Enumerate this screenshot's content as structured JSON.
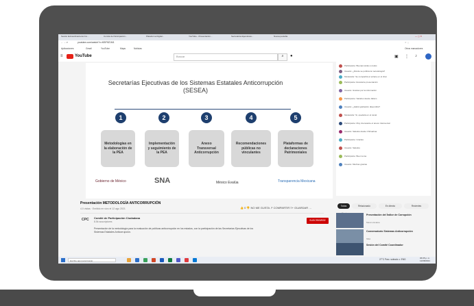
{
  "browser": {
    "tabs": [
      "Sesión Extraordinaria del Co...",
      "Comité de Participación...",
      "Plataforma Digital...",
      "YouTube - Presentación...",
      "Secretarías Ejecutivas...",
      "Nueva pestaña"
    ],
    "url": "youtube.com/watch?v=KBF9Z1M1",
    "bookmarks": [
      "Aplicaciones",
      "Gmail",
      "YouTube",
      "Maps",
      "Noticias",
      "Otros marcadores"
    ]
  },
  "youtube": {
    "logo": "YouTube",
    "search_placeholder": "Buscar"
  },
  "slide": {
    "title": "Secretarías Ejecutivas de los Sistemas Estatales Anticorrupción",
    "subtitle": "(SESEA)",
    "steps": [
      {
        "num": "1",
        "label": "Metodologías en la elaboración de la PEA"
      },
      {
        "num": "2",
        "label": "Implementación y seguimiento de la PEA"
      },
      {
        "num": "3",
        "label": "Anexo Transversal Anticorrupción"
      },
      {
        "num": "4",
        "label": "Recomendaciones públicas no vinculantes"
      },
      {
        "num": "5",
        "label": "Plataformas de declaraciones Patrimoniales"
      }
    ],
    "logos": [
      "Gobierno de México",
      "SNA",
      "México Evalúa",
      "Transparencia Mexicana"
    ]
  },
  "video": {
    "title": "Presentación METODOLOGÍA ANTICORRUPCIÓN",
    "meta": "4.0 vistas  ·  Emitido en vivo el 12 ago 2021",
    "actions": "👍 0   👎 NO ME GUSTA   ↗ COMPARTIR   ≡+ GUARDAR   …",
    "channel_short": "CPC",
    "channel": "Comité de Participación Ciudadana",
    "subs": "8.5k suscriptores",
    "subscribe": "SUSCRIBIRSE",
    "description": "Presentación de la metodología para la evaluación de políticas anticorrupción en los estados, con la participación de las Secretarías Ejecutivas de los Sistemas Estatales Anticorrupción."
  },
  "chat": {
    "messages": [
      "Participante: Buenas tardes a todos",
      "Usuario: ¿Dónde se publica la metodología?",
      "Moderador: Se compartirá el enlace en el chat",
      "Participante: Excelente presentación",
      "Usuario: Gracias por la información",
      "Participante: Saludos desde Jalisco",
      "Usuario: ¿Habrá grabación disponible?",
      "Moderador: Sí, quedará en el canal",
      "Participante: Muy interesante el anexo transversal",
      "Usuario: Saludos desde Chihuahua",
      "Participante: Gracias",
      "Usuario: Saludos",
      "Participante: Buen tema",
      "Usuario: Muchas gracias"
    ],
    "input_placeholder": "Di algo..."
  },
  "chips": [
    "Todos",
    "Relacionado",
    "En directo",
    "Recientes"
  ],
  "recommendations": [
    {
      "title": "Presentación del Índice de Corrupción",
      "channel": "México Evalúa"
    },
    {
      "title": "Conversatorio Sistemas Anticorrupción",
      "channel": "SNA"
    },
    {
      "title": "Sesión del Comité Coordinador",
      "channel": "SESNA"
    }
  ],
  "taskbar": {
    "search": "Escribe aquí para buscar",
    "status": "27°C  Parc. soleado  ∧ ENG",
    "time": "06:05 p. m.",
    "date": "12/08/2021"
  },
  "colors": {
    "laptop": "#4f4f4f",
    "youtube_red": "#e62117",
    "step_circle": "#1e3f6e",
    "step_box": "#d8d8d8"
  }
}
